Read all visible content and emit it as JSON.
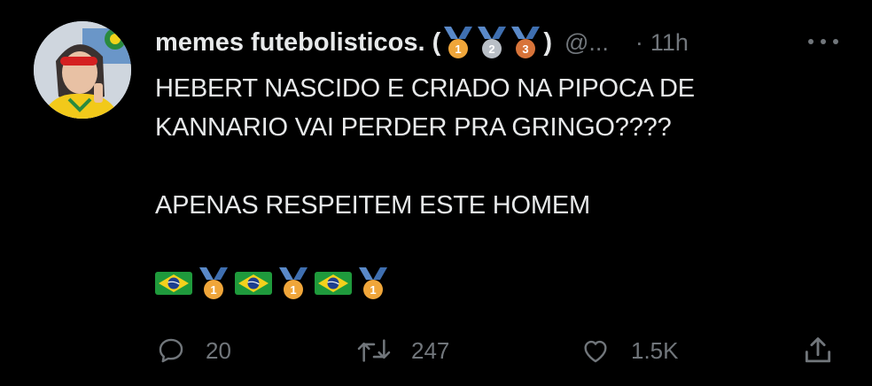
{
  "tweet": {
    "name": "memes futebolisticos. (",
    "name_close": ")",
    "name_medals": [
      {
        "icon": "gold-medal-icon",
        "number": "1",
        "color": "#f0a63a"
      },
      {
        "icon": "silver-medal-icon",
        "number": "2",
        "color": "#b9bfc6"
      },
      {
        "icon": "bronze-medal-icon",
        "number": "3",
        "color": "#d8743a"
      }
    ],
    "handle": "@...",
    "separator": "·",
    "time": "11h",
    "lines": [
      "HEBERT NASCIDO E CRIADO NA PIPOCA DE",
      "KANNARIO VAI PERDER PRA GRINGO????",
      "",
      "APENAS RESPEITEM ESTE HOMEM"
    ],
    "emoji_row": [
      "brazil-flag-icon",
      "gold-medal-icon",
      "brazil-flag-icon",
      "gold-medal-icon",
      "brazil-flag-icon",
      "gold-medal-icon"
    ],
    "gold_medal_number": "1"
  },
  "actions": {
    "reply_count": "20",
    "retweet_count": "247",
    "like_count": "1.5K"
  },
  "colors": {
    "background": "#000000",
    "text": "#e7e9ea",
    "muted": "#71767b"
  }
}
